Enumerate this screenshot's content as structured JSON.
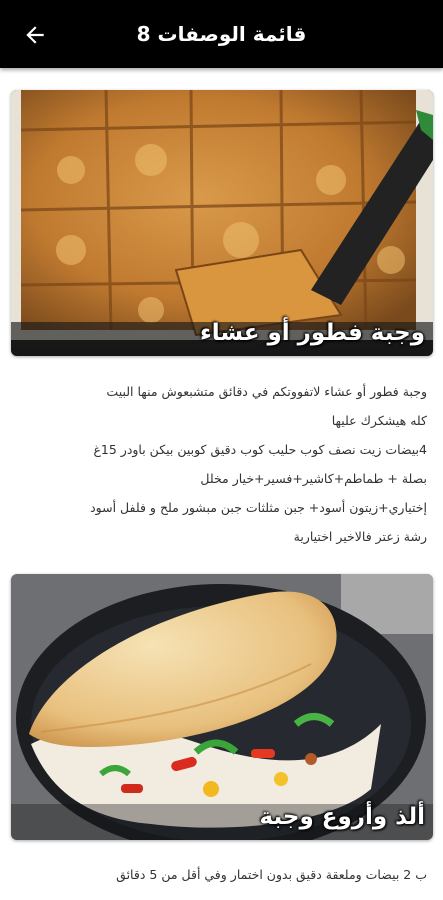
{
  "header": {
    "title": "قائمة الوصفات 8",
    "back_icon": "arrow-left-icon",
    "background": "#000000"
  },
  "recipes": [
    {
      "caption": "وجبة فطور أو عشاء",
      "image": "baked-squares-photo",
      "lines": [
        "وجبة فطور أو عشاء لاتفووتكم في دقائق متشبعوش منها البيت",
        "كله هيشكرك عليها",
        "4بيضات زيت نصف كوب حليب كوب دقيق كوبين بيكن باودر 15غ",
        "بصلة + طماطم+كاشير+فسير+خيار مخلل",
        "إختياري+زيتون أسود+ جبن مثلثات جبن مبشور ملح و فلفل أسود",
        "رشة زعتر فالاخير اختيارية"
      ]
    },
    {
      "caption": "ألذ وأروع وجبة",
      "image": "folded-omelette-photo",
      "lines": [
        "ب 2 بيضات وملعقة دقيق بدون اختمار وفي أقل من 5 دقائق"
      ]
    }
  ]
}
